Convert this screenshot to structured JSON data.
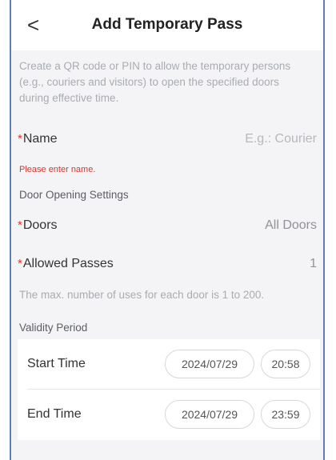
{
  "header": {
    "back_glyph": "<",
    "title": "Add Temporary Pass"
  },
  "description": "Create a QR code or PIN to allow the temporary persons (e.g., couriers and visitors) to open the specified doors during effective time.",
  "name_field": {
    "required_mark": "*",
    "label": "Name",
    "placeholder": "E.g.: Courier",
    "error": "Please enter name."
  },
  "door_settings": {
    "section_title": "Door Opening Settings",
    "doors": {
      "required_mark": "*",
      "label": "Doors",
      "value": "All Doors"
    },
    "allowed_passes": {
      "required_mark": "*",
      "label": "Allowed Passes",
      "value": "1"
    },
    "hint": "The max. number of uses for each door is 1 to 200."
  },
  "validity": {
    "section_title": "Validity Period",
    "start": {
      "label": "Start Time",
      "date": "2024/07/29",
      "time": "20:58"
    },
    "end": {
      "label": "End Time",
      "date": "2024/07/29",
      "time": "23:59"
    }
  },
  "colors": {
    "required": "#d9372f",
    "border": "#5f7fb3",
    "background": "#f4f4f6"
  }
}
